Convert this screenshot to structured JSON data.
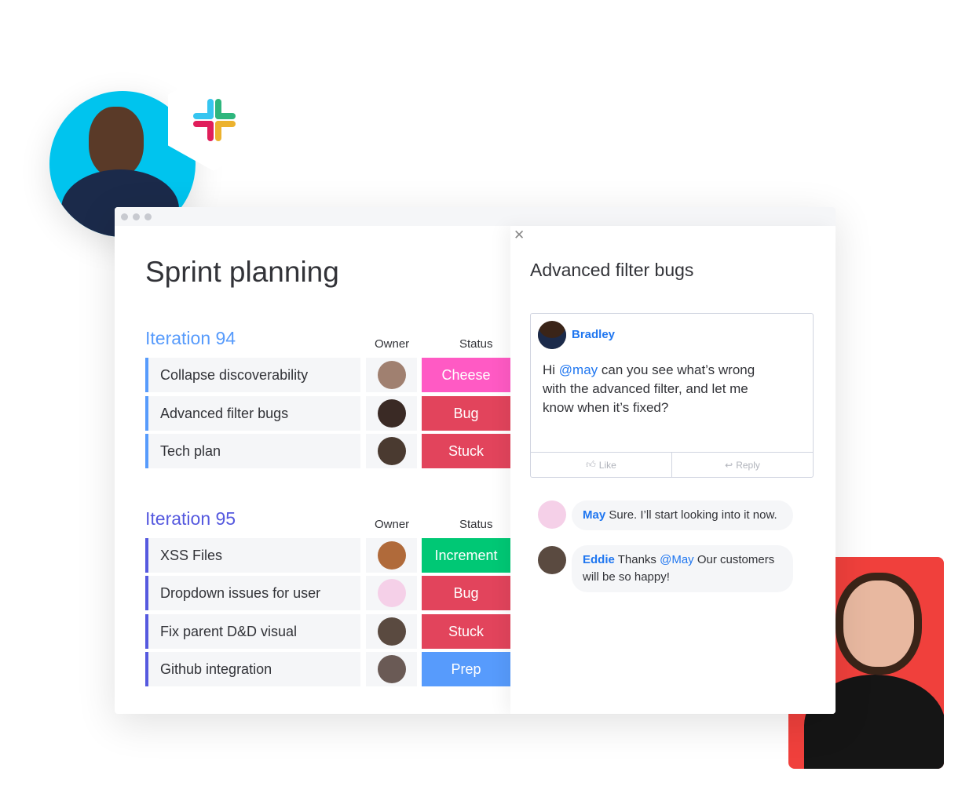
{
  "board": {
    "title": "Sprint planning",
    "groups": [
      {
        "title": "Iteration 94",
        "color": "#579bfc",
        "owner_header": "Owner",
        "status_header": "Status",
        "rows": [
          {
            "name": "Collapse discoverability",
            "status": "Cheese",
            "status_color": "#ff5ac4",
            "avatar_color": "#a08070"
          },
          {
            "name": "Advanced filter bugs",
            "status": "Bug",
            "status_color": "#e2445c",
            "avatar_color": "#3a2a25"
          },
          {
            "name": "Tech plan",
            "status": "Stuck",
            "status_color": "#e2445c",
            "avatar_color": "#4a3a30"
          }
        ]
      },
      {
        "title": "Iteration 95",
        "color": "#5559df",
        "owner_header": "Owner",
        "status_header": "Status",
        "rows": [
          {
            "name": "XSS Files",
            "status": "Increment",
            "status_color": "#00c875",
            "avatar_color": "#b06a3a"
          },
          {
            "name": "Dropdown issues for user",
            "status": "Bug",
            "status_color": "#e2445c",
            "avatar_color": "#f5d0e8"
          },
          {
            "name": "Fix parent D&D visual",
            "status": "Stuck",
            "status_color": "#e2445c",
            "avatar_color": "#5a4a40"
          },
          {
            "name": "Github integration",
            "status": "Prep",
            "status_color": "#579bfc",
            "avatar_color": "#6a5a55"
          }
        ]
      }
    ]
  },
  "panel": {
    "close_icon": "close-icon",
    "title": "Advanced filter bugs",
    "post": {
      "author": "Bradley",
      "text_prefix": "Hi ",
      "mention": "@may",
      "text_suffix": " can you see what’s wrong with the advanced filter, and let me know when it’s fixed?",
      "like_label": "Like",
      "reply_label": "Reply"
    },
    "replies": [
      {
        "author": "May",
        "text": " Sure. I’ll start looking into it now."
      },
      {
        "author": "Eddie",
        "text_prefix": " Thanks ",
        "mention": "@May",
        "text_suffix": " Our customers will be so happy!"
      }
    ]
  },
  "colors": {
    "accent": "#1f76f0",
    "hero_bg": "#00c4ee",
    "photo_bg": "#f0403c"
  }
}
